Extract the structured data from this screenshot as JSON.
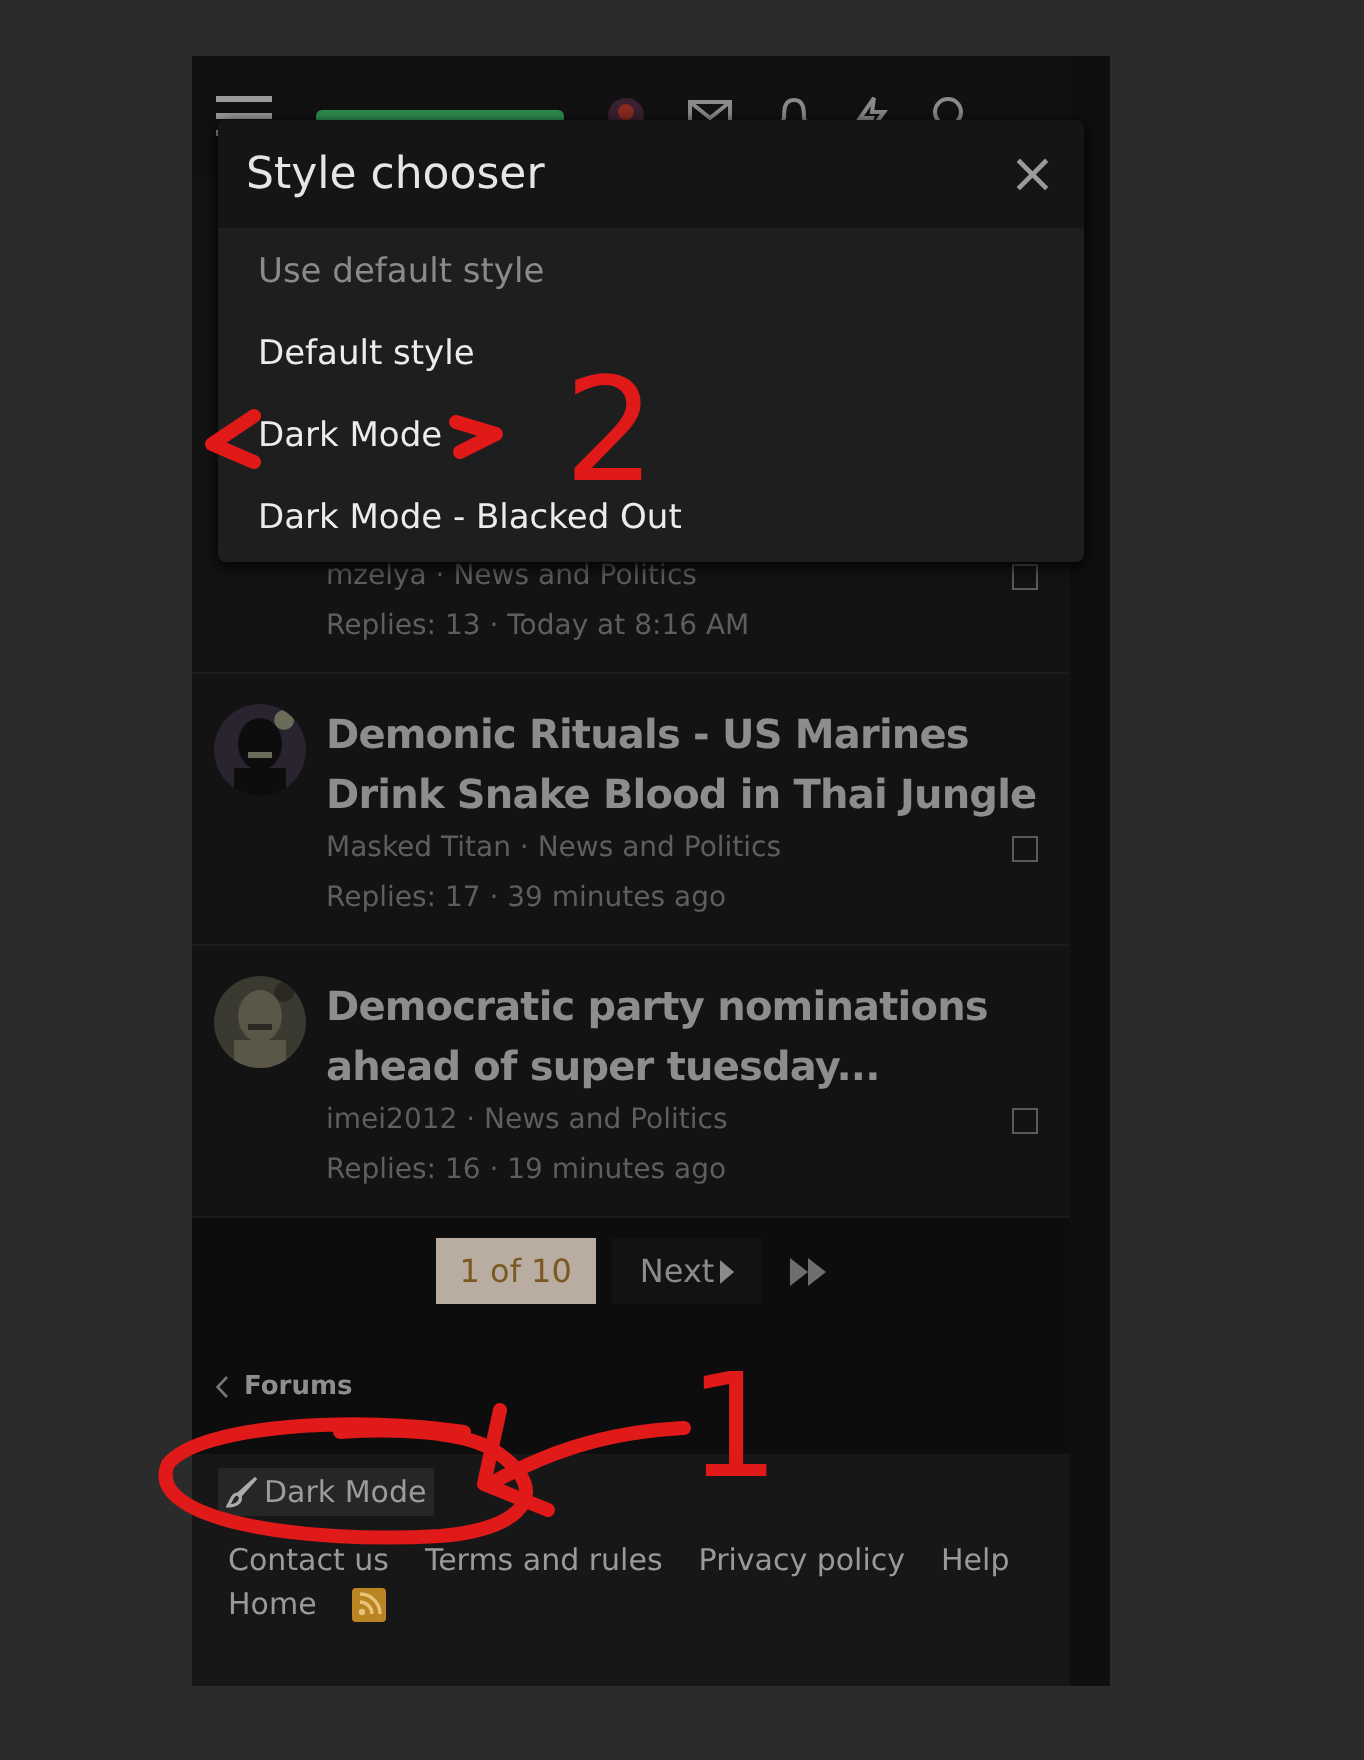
{
  "style_chooser": {
    "title": "Style chooser",
    "close": "×",
    "options": [
      {
        "label": "Use default style",
        "selected": false,
        "muted": true
      },
      {
        "label": "Default style",
        "selected": false,
        "muted": false
      },
      {
        "label": "Dark Mode",
        "selected": false,
        "muted": false
      },
      {
        "label": "Dark Mode - Blacked Out",
        "selected": false,
        "muted": false
      }
    ]
  },
  "threads": [
    {
      "byline": "mzelya · News and Politics",
      "stats": "Replies: 13 · Today at 8:16 AM",
      "avatar": false,
      "checked": false
    },
    {
      "title": "Demonic Rituals - US Marines Drink Snake Blood in Thai Jungle",
      "byline": "Masked Titan · News and Politics",
      "stats": "Replies: 17 · 39 minutes ago",
      "avatar": true,
      "checked": false
    },
    {
      "title": "Democratic party nominations ahead of super tuesday...",
      "byline": "imei2012 · News and Politics",
      "stats": "Replies: 16 · 19 minutes ago",
      "avatar": true,
      "checked": false
    }
  ],
  "pagination": {
    "current": "1 of 10",
    "next": "Next"
  },
  "breadcrumb": "Forums",
  "footer": {
    "style_button": "Dark Mode",
    "links": [
      "Contact us",
      "Terms and rules",
      "Privacy policy",
      "Help"
    ],
    "home": "Home"
  },
  "annotations": [
    {
      "kind": "brackets"
    },
    {
      "kind": "number",
      "text": "2"
    },
    {
      "kind": "circle"
    },
    {
      "kind": "arrow"
    },
    {
      "kind": "number",
      "text": "1"
    }
  ]
}
